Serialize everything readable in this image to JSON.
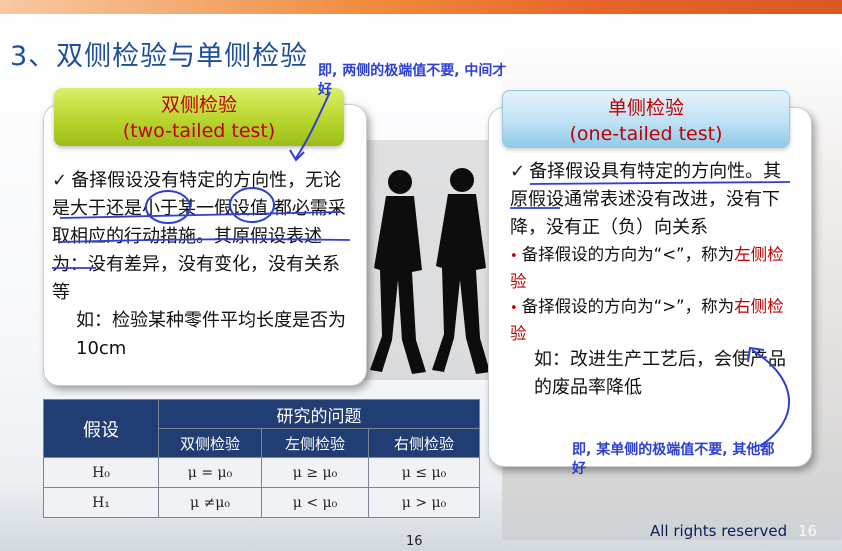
{
  "slide": {
    "title": "3、双侧检验与单侧检验",
    "page_number": "16",
    "footer_rights": "All rights reserved",
    "footer_page_faint": "16"
  },
  "left": {
    "header_cn": "双侧检验",
    "header_en": "(two-tailed test)",
    "check": "✓",
    "text_line1": "备择假设没有特定的方向性",
    "text_rest": "，无论是大于还是小于某一假设值,都必需采取相应的行动措施。其原假设表述为：没有差异，没有变化，没有关系等",
    "example": "如：检验某种零件平均长度是否为10cm"
  },
  "right": {
    "header_cn": "单侧检验",
    "header_en": "(one-tailed test)",
    "check": "✓",
    "text_line1": "备择假设具有特定的方向性。其原假设通常表述没有改进，没有下降，没有正（负）向关系",
    "bullet1_pre": "备择假设的方向为“<”，称为",
    "bullet1_red": "左侧检验",
    "bullet2_pre": "备择假设的方向为“>”，称为",
    "bullet2_red": "右侧检验",
    "example": "如：改进生产工艺后，会使产品的废品率降低"
  },
  "annotations": {
    "top": "即, 两侧的极端值不要, 中间才好",
    "bottom": "即, 某单侧的极端值不要, 其他都好"
  },
  "table": {
    "col0_header": "假设",
    "group_header": "研究的问题",
    "sub_headers": [
      "双侧检验",
      "左侧检验",
      "右侧检验"
    ],
    "rows": [
      {
        "label": "H₀",
        "cells": [
          "μ = μ₀",
          "μ ≥ μ₀",
          "μ ≤ μ₀"
        ]
      },
      {
        "label": "H₁",
        "cells": [
          "μ ≠μ₀",
          "μ < μ₀",
          "μ > μ₀"
        ]
      }
    ]
  },
  "colors": {
    "title": "#1f4e9a",
    "header_text": "#c00000",
    "annotation": "#2d3fd6",
    "table_header_bg": "#213d73"
  }
}
